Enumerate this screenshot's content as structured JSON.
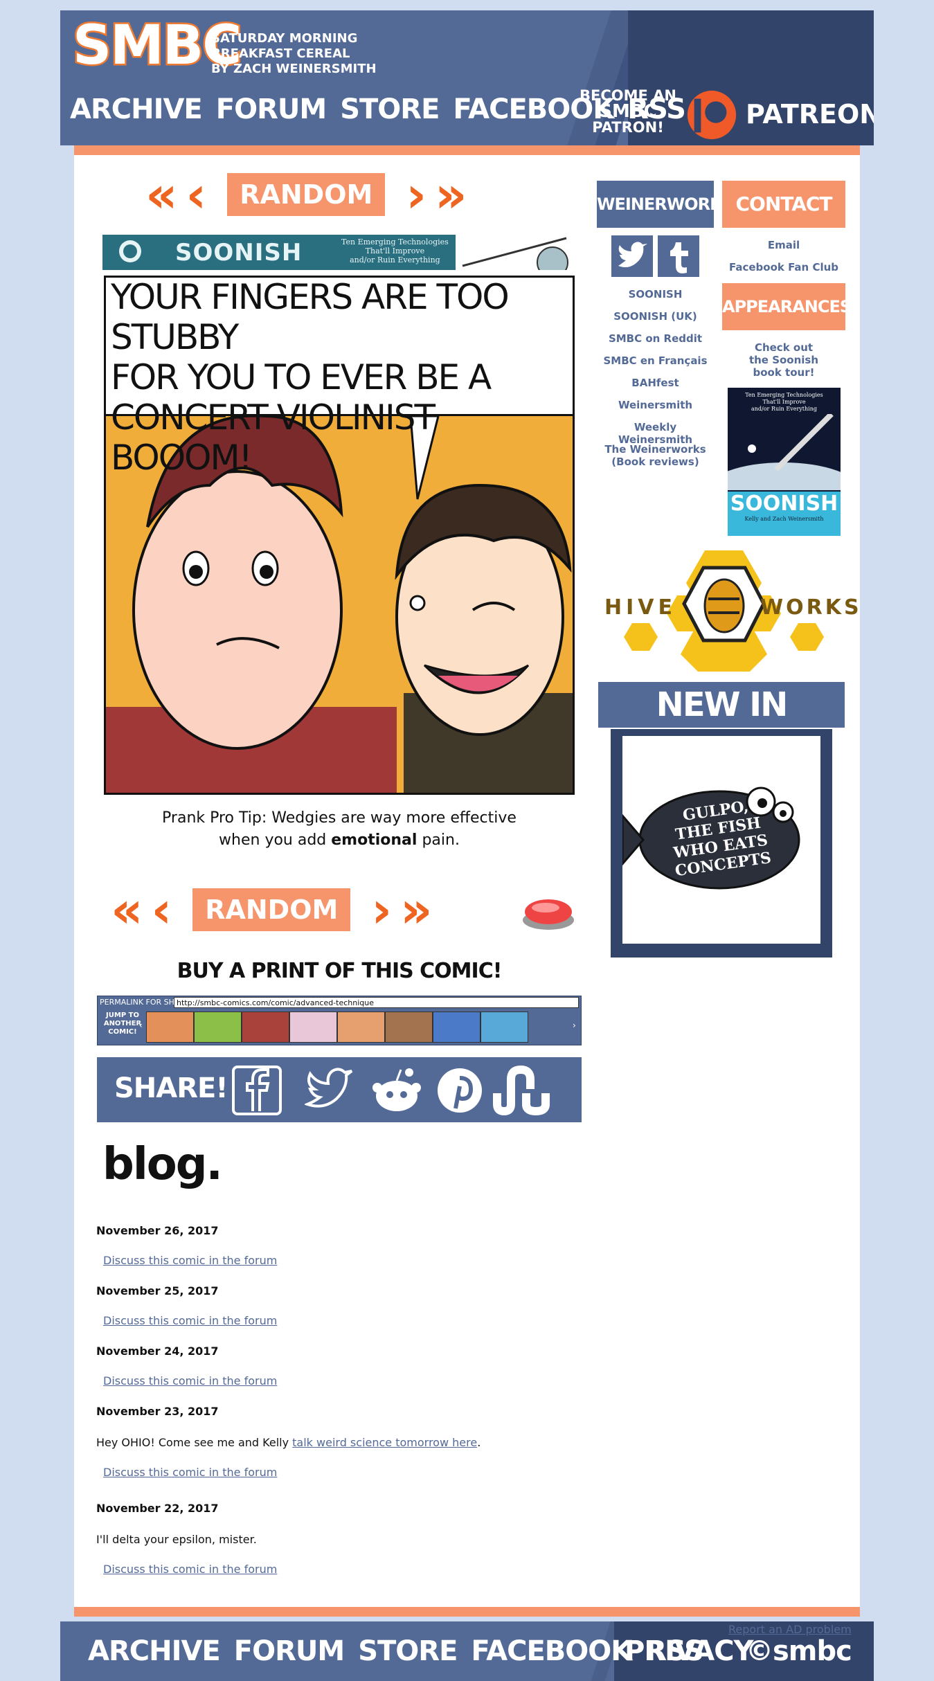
{
  "header": {
    "logo": "SMBC",
    "tagline": [
      "Saturday Morning",
      "Breakfast Cereal",
      "by Zach Weinersmith"
    ],
    "nav": [
      "Archive",
      "Forum",
      "Store",
      "Facebook",
      "RSS"
    ],
    "patron_text": [
      "Become an",
      "SMBC",
      "Patron!"
    ],
    "patreon_label": "PATREON"
  },
  "comic_nav": {
    "random_label": "RANDOM"
  },
  "soonish_banner": {
    "title": "SOONISH",
    "subtitle": [
      "Ten Emerging Technologies",
      "That'll Improve",
      "and/or Ruin Everything"
    ]
  },
  "comic": {
    "speech": [
      "YOUR FINGERS ARE TOO STUBBY",
      "FOR YOU TO EVER BE A",
      "CONCERT VIOLINIST BOOOM!"
    ],
    "caption_line1": "Prank Pro Tip: Wedgies are way more effective",
    "caption_pre": "when you add ",
    "caption_bold": "emotional",
    "caption_post": " pain."
  },
  "buy_print": "Buy a print of this comic!",
  "permalink": {
    "label": "Permalink for sharing!",
    "url": "http://smbc-comics.com/comic/advanced-technique",
    "jump_label": "Jump to another comic!"
  },
  "share": {
    "label": "Share!"
  },
  "blog": {
    "title": "blog.",
    "discuss_label": "Discuss this comic in the forum",
    "entries": [
      {
        "date": "November 26, 2017"
      },
      {
        "date": "November 25, 2017"
      },
      {
        "date": "November 24, 2017"
      },
      {
        "date": "November 23, 2017",
        "text_pre": "Hey OHIO! Come see me and Kelly ",
        "link": "talk weird science tomorrow here",
        "text_post": "."
      },
      {
        "date": "November 22, 2017",
        "text": "I'll delta your epsilon, mister."
      }
    ]
  },
  "sidebar": {
    "weinerworks": "Weinerworks",
    "contact": "Contact",
    "email": "Email",
    "facebook_fan_club": "Facebook Fan Club",
    "appearances": "Appearances",
    "appearances_text": [
      "Check out",
      "the Soonish",
      "book tour!"
    ],
    "links": [
      "SOONISH",
      "SOONISH (UK)",
      "SMBC on Reddit",
      "SMBC en Français",
      "BAHfest",
      "Weinersmith",
      "Weekly Weinersmith",
      "The Weinerworks",
      "(Book reviews)"
    ],
    "book_title": "SOONISH",
    "book_subtitle": [
      "Ten Emerging Technologies",
      "That'll Improve",
      "and/or Ruin Everything"
    ],
    "book_authors": "Kelly and Zach Weinersmith",
    "hive_left": "HIVE",
    "hive_right": "WORKS",
    "new_in_store": "New in Store",
    "store_item_text": [
      "GULPO,",
      "THE FISH",
      "WHO EATS",
      "CONCEPTS"
    ]
  },
  "footer": {
    "nav": [
      "Archive",
      "Forum",
      "Store",
      "Facebook",
      "RSS"
    ],
    "privacy": "Privacy",
    "copyright": "©smbc",
    "report_ad": "Report an AD problem"
  },
  "colors": {
    "page_bg": "#d0ddf0",
    "header_blue": "#546a96",
    "header_dark": "#33446a",
    "accent_orange": "#f6956b",
    "arrow_orange": "#ee6521",
    "link_blue": "#546a96"
  }
}
